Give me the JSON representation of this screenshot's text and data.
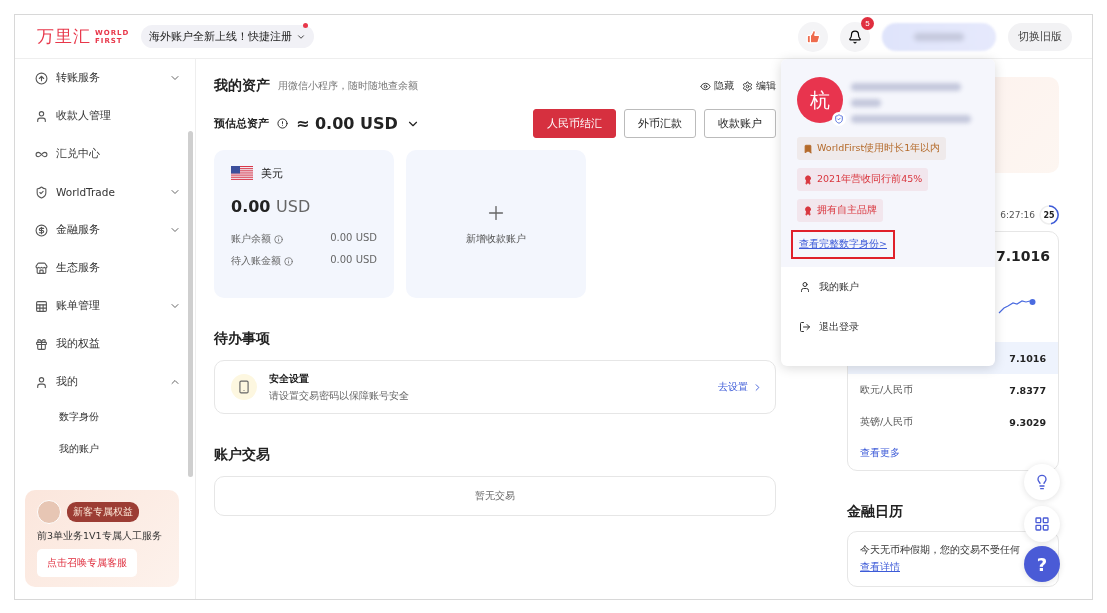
{
  "header": {
    "logo": {
      "cn": "万里汇",
      "en_1": "WORLD",
      "en_2": "FIRST"
    },
    "promo_pill": {
      "label": "海外账户全新上线！快捷注册",
      "dot": true
    },
    "notifications": {
      "count": "5"
    },
    "switch_button": "切换旧版"
  },
  "sidebar": {
    "items": [
      {
        "label": "转账服务",
        "expanded": false
      },
      {
        "label": "收款人管理"
      },
      {
        "label": "汇兑中心"
      },
      {
        "label": "WorldTrade",
        "expanded": false
      },
      {
        "label": "金融服务",
        "expanded": false
      },
      {
        "label": "生态服务"
      },
      {
        "label": "账单管理",
        "expanded": false
      },
      {
        "label": "我的权益"
      },
      {
        "label": "我的",
        "expanded": true,
        "children": [
          {
            "label": "数字身份"
          },
          {
            "label": "我的账户"
          }
        ]
      }
    ],
    "promo": {
      "badge": "新客专属权益",
      "text": "前3单业务1V1专属人工服务",
      "button": "点击召唤专属客服"
    }
  },
  "assets": {
    "title": "我的资产",
    "subtitle": "用微信小程序，随时随地查余额",
    "actions": [
      "隐藏",
      "编辑"
    ],
    "total_label": "预估总资产",
    "total_prefix": "≈",
    "total_amount": "0.00 USD",
    "buttons": [
      {
        "label": "人民币结汇",
        "kind": "primary"
      },
      {
        "label": "外币汇款",
        "kind": "outline"
      },
      {
        "label": "收款账户",
        "kind": "outline"
      }
    ],
    "accounts": [
      {
        "currency_name": "美元",
        "amount": "0.00",
        "currency": "USD",
        "rows": [
          {
            "label": "账户余额",
            "value": "0.00 USD"
          },
          {
            "label": "待入账金额",
            "value": "0.00 USD"
          }
        ]
      }
    ],
    "add_account": "新增收款账户"
  },
  "todo": {
    "title": "待办事项",
    "items": [
      {
        "title": "安全设置",
        "desc": "请设置交易密码以保障账号安全",
        "action": "去设置"
      }
    ]
  },
  "transactions": {
    "title": "账户交易",
    "empty": "暂无交易"
  },
  "rates": {
    "countdown": "6:27:16",
    "timer": "25",
    "headline": "7.1016",
    "rows": [
      {
        "value": "7.1016",
        "selected": true
      },
      {
        "pair": "欧元/人民币",
        "value": "7.8377",
        "selected": false
      },
      {
        "pair": "英镑/人民币",
        "value": "9.3029",
        "selected": false
      }
    ],
    "more": "查看更多"
  },
  "calendar": {
    "title": "金融日历",
    "text": "今天无币种假期，您的交易不受任何",
    "link": "查看详情"
  },
  "profile_menu": {
    "avatar_char": "杭",
    "tags": [
      {
        "label": "WorldFirst使用时长1年以内",
        "color": "#b46a2a"
      },
      {
        "label": "2021年营收同行前45%",
        "color": "#d9363e"
      },
      {
        "label": "拥有自主品牌",
        "color": "#d9363e"
      }
    ],
    "link": "查看完整数字身份>",
    "link_highlighted": true,
    "items": [
      "我的账户",
      "退出登录"
    ]
  },
  "help_button": "?"
}
